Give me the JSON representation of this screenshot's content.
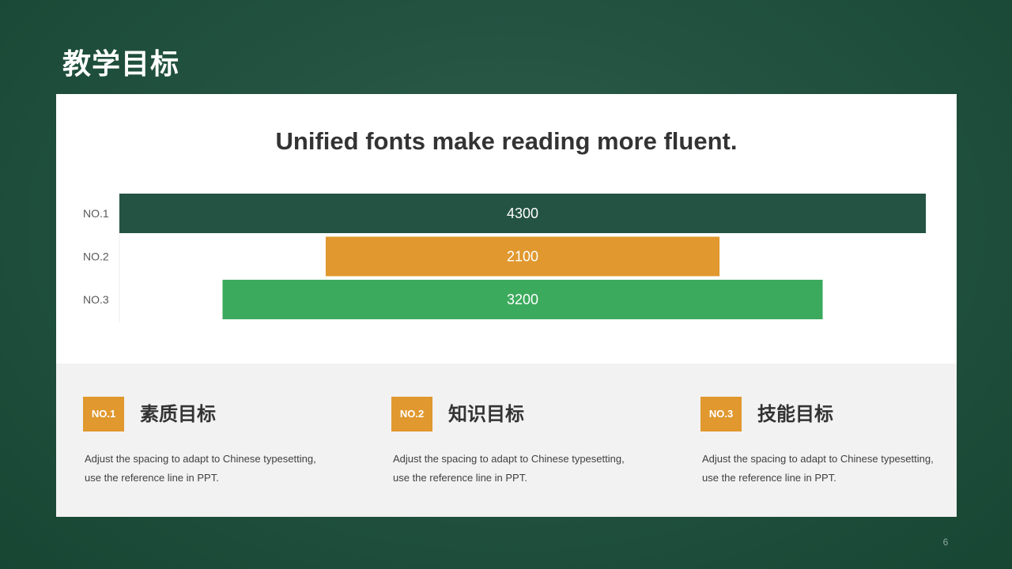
{
  "slide": {
    "title": "教学目标",
    "page_number": "6"
  },
  "chart_data": {
    "type": "bar",
    "orientation": "horizontal",
    "title": "Unified fonts make reading more fluent.",
    "categories": [
      "NO.1",
      "NO.2",
      "NO.3"
    ],
    "values": [
      4300,
      2100,
      3200
    ],
    "data_labels": [
      "4300",
      "2100",
      "3200"
    ],
    "colors": [
      "#245343",
      "#e0982f",
      "#3caa5c"
    ],
    "alignment": "center",
    "xlim": [
      0,
      4300
    ],
    "grid": false,
    "legend": "none"
  },
  "goals": [
    {
      "badge": "NO.1",
      "title": "素质目标",
      "description": "Adjust the spacing to adapt to Chinese typesetting, use the reference line in PPT."
    },
    {
      "badge": "NO.2",
      "title": "知识目标",
      "description": "Adjust the spacing to adapt to Chinese typesetting, use the reference line in PPT."
    },
    {
      "badge": "NO.3",
      "title": "技能目标",
      "description": "Adjust the spacing to adapt to Chinese typesetting, use the reference line in PPT."
    }
  ],
  "colors": {
    "background": "#235241",
    "badge": "#e0982f",
    "panel": "#ffffff",
    "bottom_panel": "#f2f2f2"
  }
}
